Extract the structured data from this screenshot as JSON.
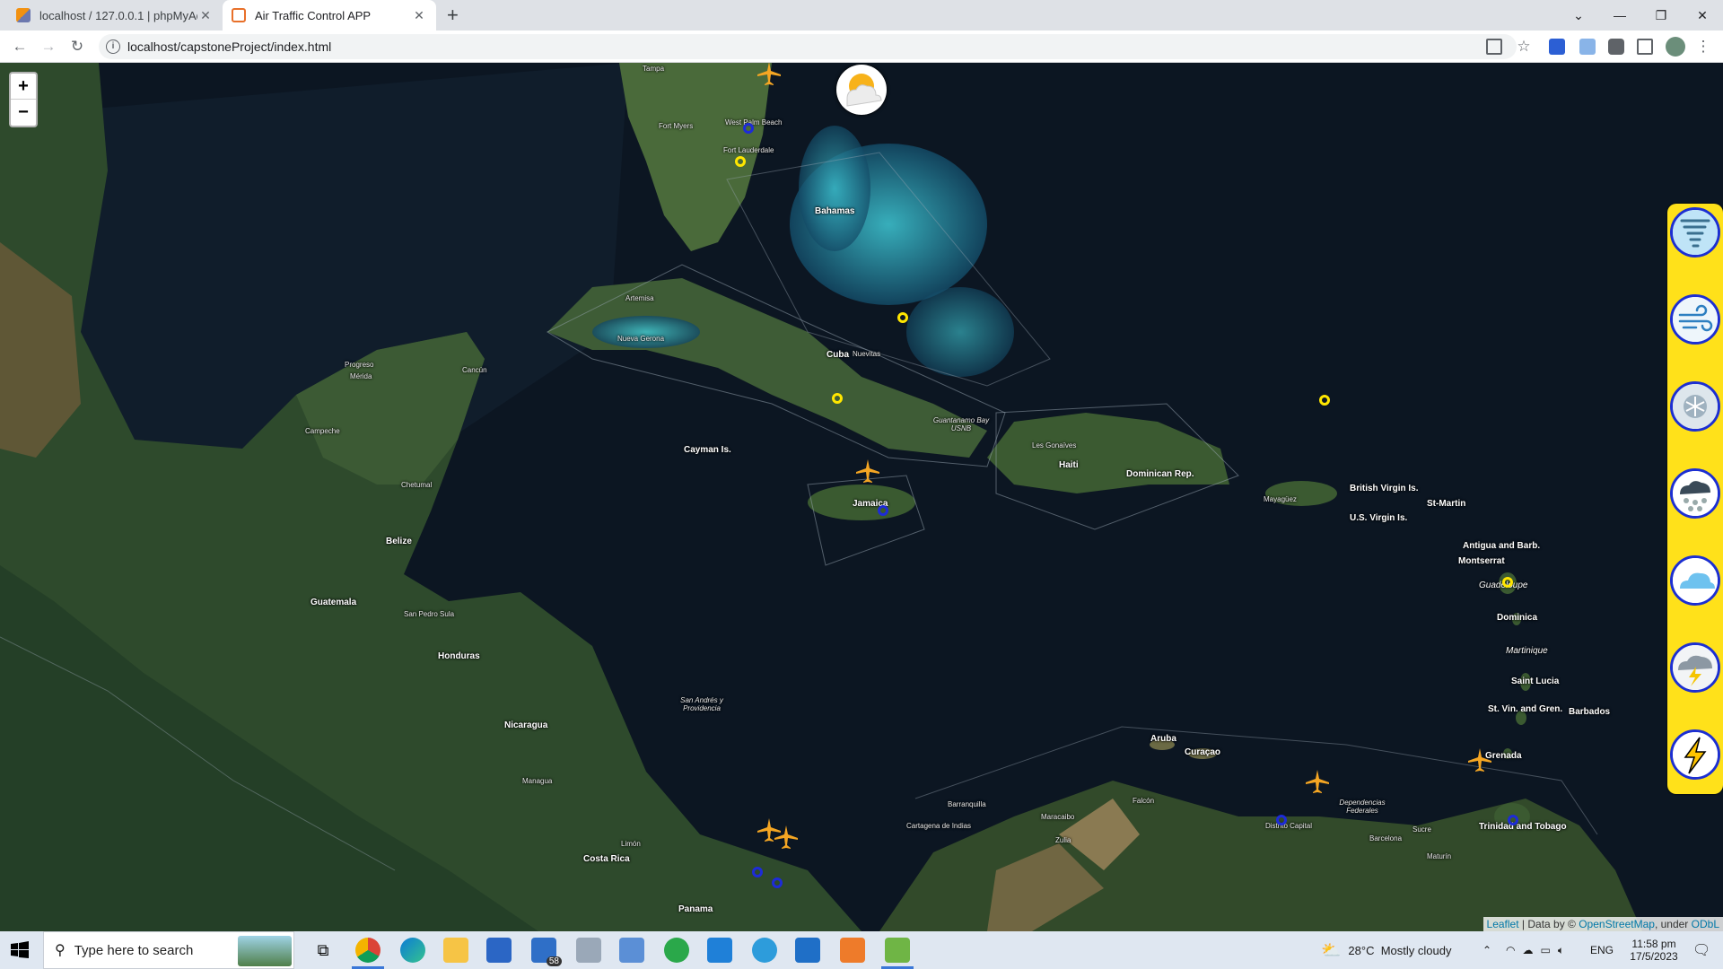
{
  "browser": {
    "tabs": [
      {
        "label": "localhost / 127.0.0.1 | phpMyAdmin",
        "active": false
      },
      {
        "label": "Air Traffic Control APP",
        "active": true
      }
    ],
    "new_tab": "+",
    "url": "localhost/capstoneProject/index.html"
  },
  "map": {
    "zoom_in": "+",
    "zoom_out": "−",
    "labels": {
      "bahamas": "Bahamas",
      "cuba": "Cuba",
      "cayman": "Cayman Is.",
      "jamaica": "Jamaica",
      "haiti": "Haiti",
      "dominican": "Dominican Rep.",
      "bvi": "British Virgin Is.",
      "usvi": "U.S. Virgin Is.",
      "stmartin": "St-Martin",
      "antigua": "Antigua and Barb.",
      "montserrat": "Montserrat",
      "guadeloupe": "Guadeloupe",
      "dominica": "Dominica",
      "martinique": "Martinique",
      "stlucia": "Saint Lucia",
      "stvin": "St. Vin. and Gren.",
      "barbados": "Barbados",
      "grenada": "Grenada",
      "trinidad": "Trinidad and Tobago",
      "aruba": "Aruba",
      "curacao": "Curaçao",
      "belize": "Belize",
      "guatemala": "Guatemala",
      "honduras": "Honduras",
      "nicaragua": "Nicaragua",
      "costarica": "Costa Rica",
      "panama": "Panama",
      "lesgonaives": "Les Gonaïves",
      "mayaguez": "Mayagüez",
      "nuevagerona": "Nueva Gerona",
      "artemisa": "Artemisa",
      "nuevitas": "Nuevitas",
      "guantanamo": "Guantanamo Bay USNB",
      "fortmyers": "Fort Myers",
      "westpalm": "West Palm Beach",
      "ftlauderdale": "Fort Lauderdale",
      "tampa": "Tampa",
      "merida": "Mérida",
      "cancun": "Cancún",
      "progreso": "Progreso",
      "campeche": "Campeche",
      "chetumal": "Chetumal",
      "sanpedrosula": "San Pedro Sula",
      "managua": "Managua",
      "limon": "Limón",
      "sanandres": "San Andrés y Providencia",
      "cartagena": "Cartagena de Indias",
      "barranquilla": "Barranquilla",
      "maracaibo": "Maracaibo",
      "caracas": "Distrito Capital",
      "barcelona": "Barcelona",
      "sucre": "Sucre",
      "maturin": "Maturín",
      "zulia": "Zulia",
      "falcon": "Falcón",
      "dependencias": "Dependencias Federales"
    },
    "attribution": {
      "leaflet": "Leaflet",
      "sep": " | Data by © ",
      "osm": "OpenStreetMap",
      "under": ", under ",
      "odbl": "ODbL"
    },
    "weather_layers": [
      "tornado-icon",
      "wind-icon",
      "snowflake-icon",
      "hail-icon",
      "cloud-icon",
      "storm-icon",
      "lightning-icon"
    ]
  },
  "taskbar": {
    "search_placeholder": "Type here to search",
    "mail_badge": "58",
    "weather": "28°C  Mostly cloudy",
    "language": "ENG",
    "time": "11:58 pm",
    "date": "17/5/2023"
  },
  "colors": {
    "plane": "#f5a623",
    "marker_yellow": "#ffe600",
    "marker_blue": "#1d2bd8",
    "panel": "#ffe11a"
  }
}
